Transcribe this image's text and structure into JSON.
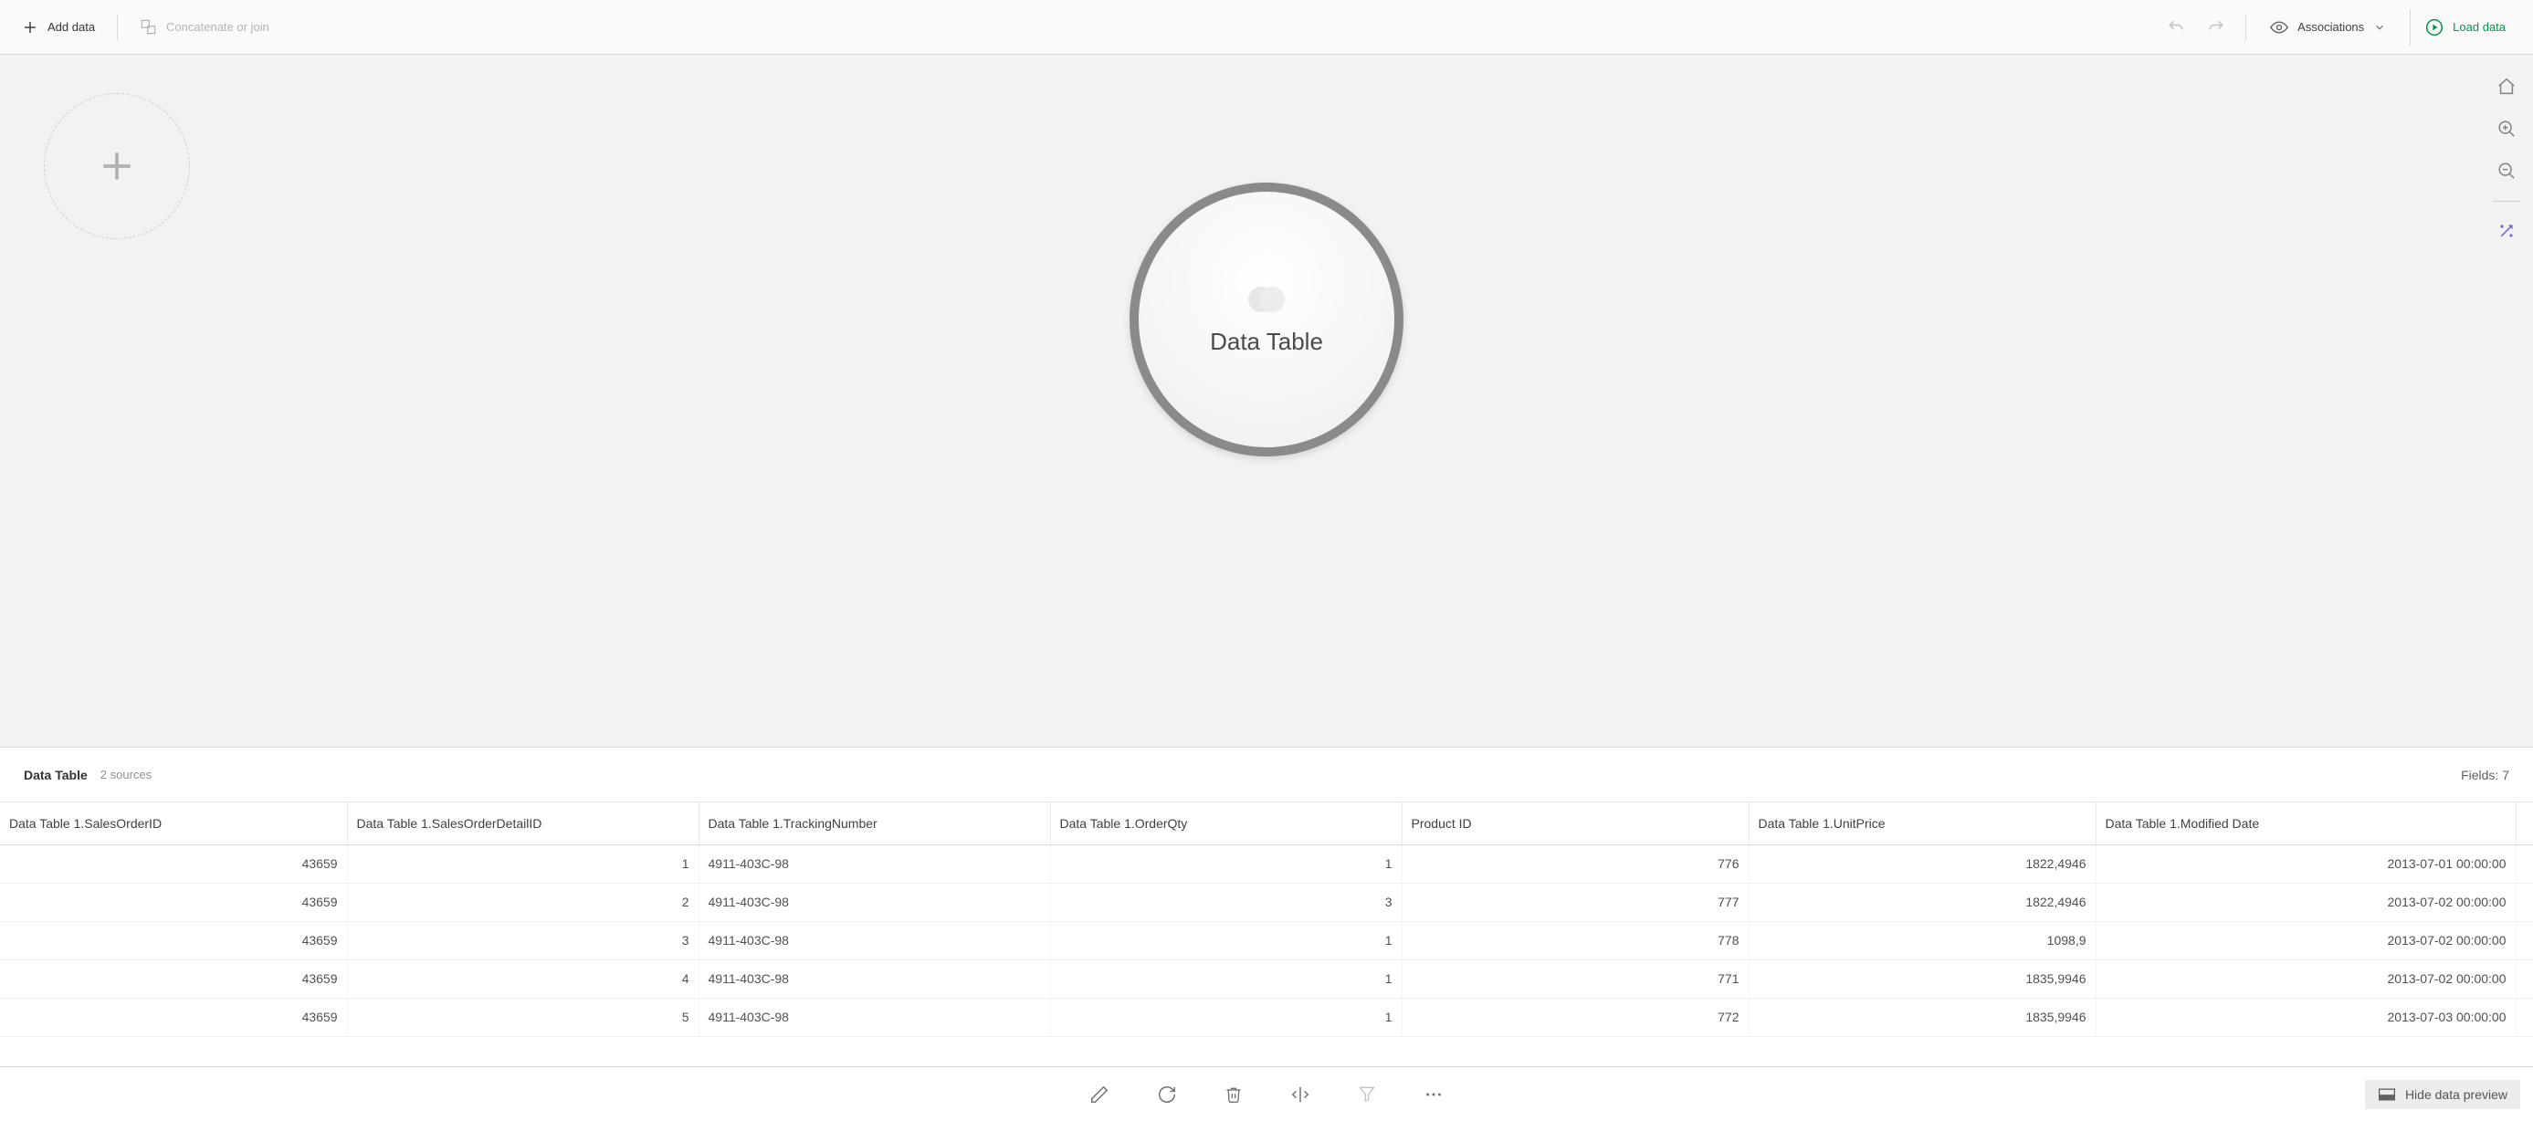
{
  "toolbar": {
    "add_data_label": "Add data",
    "concat_label": "Concatenate or join",
    "associations_label": "Associations",
    "load_data_label": "Load data"
  },
  "canvas": {
    "table_bubble_label": "Data Table"
  },
  "preview": {
    "title": "Data Table",
    "sources_label": "2 sources",
    "fields_label": "Fields: 7",
    "hide_label": "Hide data preview"
  },
  "table": {
    "columns": [
      "Data Table 1.SalesOrderID",
      "Data Table 1.SalesOrderDetailID",
      "Data Table 1.TrackingNumber",
      "Data Table 1.OrderQty",
      "Product ID",
      "Data Table 1.UnitPrice",
      "Data Table 1.Modified Date"
    ],
    "column_types": [
      "num",
      "num",
      "text",
      "num",
      "num",
      "num",
      "text-right"
    ],
    "rows": [
      [
        "43659",
        "1",
        "4911-403C-98",
        "1",
        "776",
        "1822,4946",
        "2013-07-01 00:00:00"
      ],
      [
        "43659",
        "2",
        "4911-403C-98",
        "3",
        "777",
        "1822,4946",
        "2013-07-02 00:00:00"
      ],
      [
        "43659",
        "3",
        "4911-403C-98",
        "1",
        "778",
        "1098,9",
        "2013-07-02 00:00:00"
      ],
      [
        "43659",
        "4",
        "4911-403C-98",
        "1",
        "771",
        "1835,9946",
        "2013-07-02 00:00:00"
      ],
      [
        "43659",
        "5",
        "4911-403C-98",
        "1",
        "772",
        "1835,9946",
        "2013-07-03 00:00:00"
      ]
    ]
  }
}
